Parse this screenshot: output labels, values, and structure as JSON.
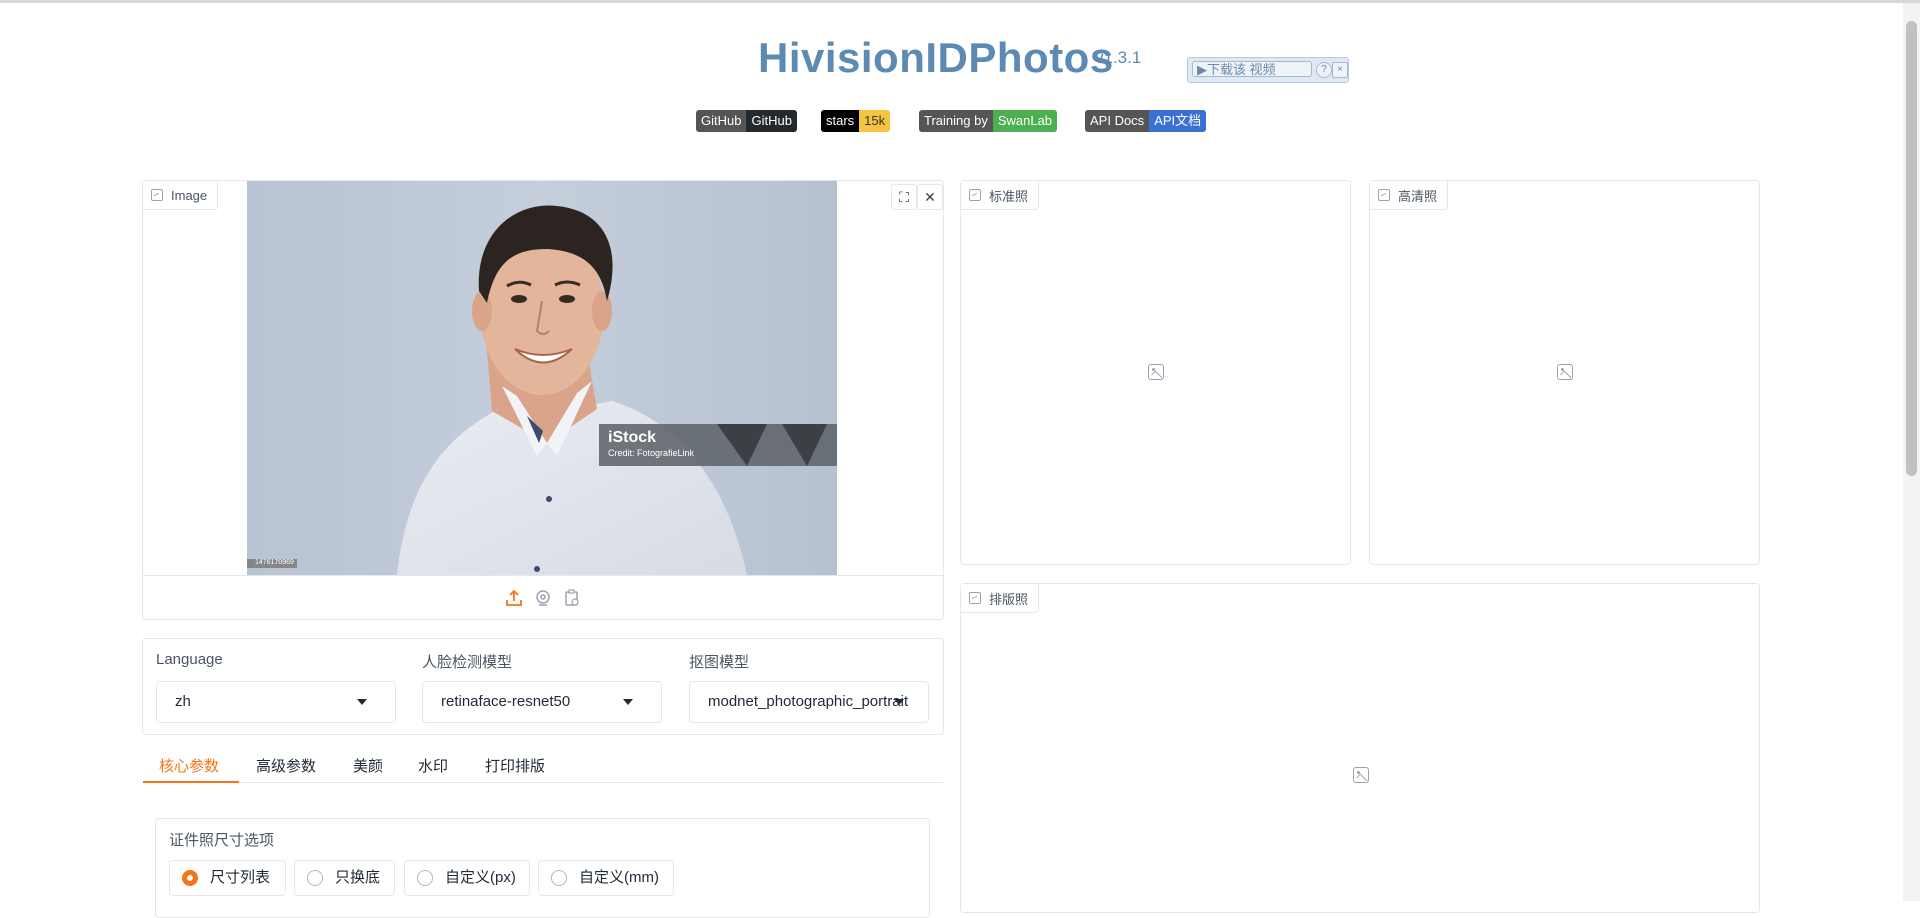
{
  "header": {
    "title": "HivisionIDPhotos",
    "version": "v1.3.1",
    "promo_label": "▶下载该 视频",
    "promo_help": "?",
    "promo_close": "×"
  },
  "badges": [
    {
      "left": "GitHub",
      "right": "GitHub",
      "color": "#24292e"
    },
    {
      "left": "stars",
      "right": "15k",
      "color": "#f5c542"
    },
    {
      "left": "Training by",
      "right": "SwanLab",
      "color": "#4caf50"
    },
    {
      "left": "API Docs",
      "right": "API文档",
      "color": "#3b6fd1"
    }
  ],
  "image_panel": {
    "label": "Image",
    "fullscreen_icon": "⛶",
    "close_icon": "✕",
    "watermark_brand": "iStock",
    "watermark_credit": "Credit: FotografieLink",
    "stock_id": "1476170969"
  },
  "output_panels": {
    "standard": "标准照",
    "hd": "高清照",
    "layout": "排版照"
  },
  "settings": {
    "language_label": "Language",
    "language_value": "zh",
    "face_model_label": "人脸检测模型",
    "face_model_value": "retinaface-resnet50",
    "matting_model_label": "抠图模型",
    "matting_model_value": "modnet_photographic_portrait"
  },
  "tabs": [
    "核心参数",
    "高级参数",
    "美颜",
    "水印",
    "打印排版"
  ],
  "size_options": {
    "label": "证件照尺寸选项",
    "options": [
      "尺寸列表",
      "只换底",
      "自定义(px)",
      "自定义(mm)"
    ],
    "selected": "尺寸列表"
  },
  "colors": {
    "accent": "#f97316",
    "title": "#5c8ab3",
    "border": "#e5e7eb"
  }
}
